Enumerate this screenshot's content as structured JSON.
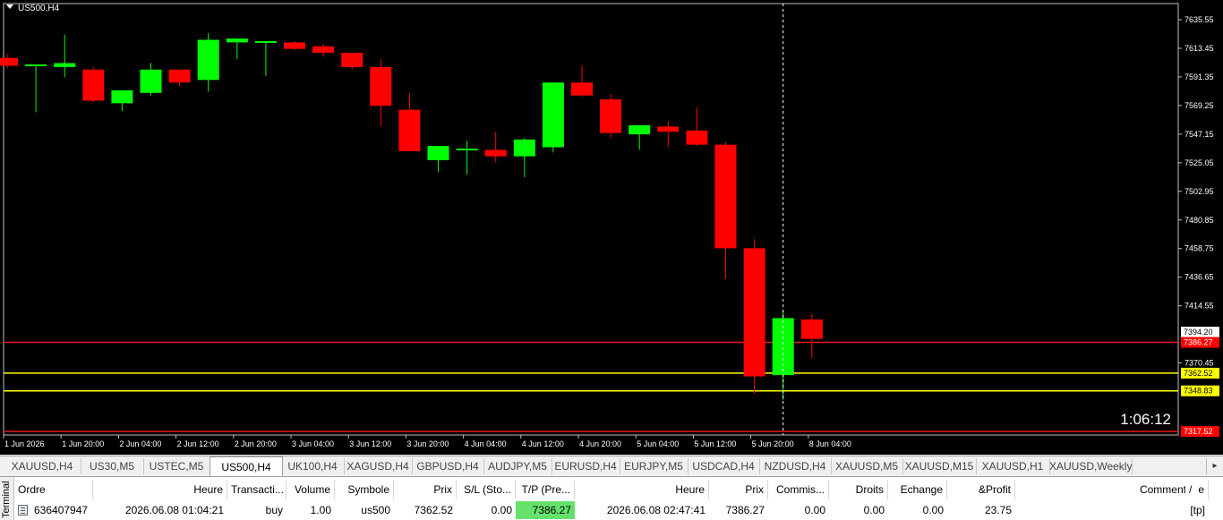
{
  "chart": {
    "symbol": "US500,H4",
    "timer": "1:06:12",
    "colors": {
      "bull": "#00ff00",
      "bear": "#ff0000",
      "wick_bull": "#00ff00",
      "wick_bear": "#ff0000",
      "background": "#000000",
      "axis_text": "#ffffff",
      "level_red": "#e8191b",
      "level_yellow": "#ffff00",
      "crosshair": "#ffffff"
    },
    "price_axis": [
      "7635.55",
      "7613.45",
      "7591.35",
      "7569.25",
      "7547.15",
      "7525.05",
      "7502.95",
      "7480.85",
      "7458.75",
      "7436.65",
      "7414.55",
      "7370.45"
    ],
    "price_tags": [
      {
        "value": 7394.2,
        "label": "7394.20",
        "bg": "#ffffff",
        "fg": "#000000"
      },
      {
        "value": 7386.27,
        "label": "7386.27",
        "bg": "#ff0000",
        "fg": "#ffffff"
      },
      {
        "value": 7362.52,
        "label": "7362.52",
        "bg": "#ffff00",
        "fg": "#000000"
      },
      {
        "value": 7348.83,
        "label": "7348.83",
        "bg": "#ffff00",
        "fg": "#000000"
      },
      {
        "value": 7317.52,
        "label": "7317.52",
        "bg": "#ff0000",
        "fg": "#ffffff"
      }
    ],
    "levels": [
      {
        "value": 7386.27,
        "color": "#e8191b"
      },
      {
        "value": 7362.52,
        "color": "#ffff00"
      },
      {
        "value": 7348.83,
        "color": "#ffff00"
      },
      {
        "value": 7317.52,
        "color": "#e8191b"
      }
    ],
    "time_labels": [
      "1 Jun 2026",
      "1 Jun 20:00",
      "2 Jun 04:00",
      "2 Jun 12:00",
      "2 Jun 20:00",
      "3 Jun 04:00",
      "3 Jun 12:00",
      "3 Jun 20:00",
      "4 Jun 04:00",
      "4 Jun 12:00",
      "4 Jun 20:00",
      "5 Jun 04:00",
      "5 Jun 12:00",
      "5 Jun 20:00",
      "8 Jun 04:00"
    ],
    "candles": [
      {
        "o": 7606,
        "h": 7609,
        "l": 7598,
        "c": 7600
      },
      {
        "o": 7601,
        "h": 7601,
        "l": 7564,
        "c": 7601
      },
      {
        "o": 7599,
        "h": 7624,
        "l": 7591,
        "c": 7602
      },
      {
        "o": 7597,
        "h": 7599,
        "l": 7572,
        "c": 7573
      },
      {
        "o": 7571,
        "h": 7581,
        "l": 7565,
        "c": 7581
      },
      {
        "o": 7579,
        "h": 7602,
        "l": 7577,
        "c": 7597
      },
      {
        "o": 7597,
        "h": 7597,
        "l": 7584,
        "c": 7587
      },
      {
        "o": 7589,
        "h": 7625,
        "l": 7580,
        "c": 7620
      },
      {
        "o": 7618,
        "h": 7621,
        "l": 7605,
        "c": 7621
      },
      {
        "o": 7619,
        "h": 7619,
        "l": 7592,
        "c": 7619
      },
      {
        "o": 7618,
        "h": 7619,
        "l": 7612,
        "c": 7613
      },
      {
        "o": 7615,
        "h": 7617,
        "l": 7607,
        "c": 7610
      },
      {
        "o": 7610,
        "h": 7610,
        "l": 7597,
        "c": 7599
      },
      {
        "o": 7599,
        "h": 7605,
        "l": 7553,
        "c": 7569
      },
      {
        "o": 7566,
        "h": 7579,
        "l": 7541,
        "c": 7534
      },
      {
        "o": 7527,
        "h": 7538,
        "l": 7518,
        "c": 7538
      },
      {
        "o": 7536,
        "h": 7542,
        "l": 7516,
        "c": 7536
      },
      {
        "o": 7535,
        "h": 7549,
        "l": 7525,
        "c": 7530
      },
      {
        "o": 7530,
        "h": 7544,
        "l": 7514,
        "c": 7543
      },
      {
        "o": 7537,
        "h": 7587,
        "l": 7533,
        "c": 7587
      },
      {
        "o": 7587,
        "h": 7600,
        "l": 7576,
        "c": 7577
      },
      {
        "o": 7574,
        "h": 7578,
        "l": 7544,
        "c": 7548
      },
      {
        "o": 7547,
        "h": 7554,
        "l": 7535,
        "c": 7554
      },
      {
        "o": 7553,
        "h": 7557,
        "l": 7537,
        "c": 7549
      },
      {
        "o": 7550,
        "h": 7568,
        "l": 7538,
        "c": 7539
      },
      {
        "o": 7539,
        "h": 7541,
        "l": 7435,
        "c": 7459
      },
      {
        "o": 7459,
        "h": 7466,
        "l": 7347,
        "c": 7360
      },
      {
        "o": 7361,
        "h": 7411,
        "l": 7342,
        "c": 7405
      },
      {
        "o": 7404,
        "h": 7408,
        "l": 7374,
        "c": 7389
      }
    ],
    "ylim": [
      7317.52,
      7635.55
    ],
    "crosshair_candle_index": 27
  },
  "tabs": {
    "active_index": 3,
    "items": [
      "XAUUSD,H4",
      "US30,M5",
      "USTEC,M5",
      "US500,H4",
      "UK100,H4",
      "XAGUSD,H4",
      "GBPUSD,H4",
      "AUDJPY,M5",
      "EURUSD,H4",
      "EURJPY,M5",
      "USDCAD,H4",
      "NZDUSD,H4",
      "XAUUSD,M5",
      "XAUUSD,M15",
      "XAUUSD,H1",
      "XAUUSD,Weekly"
    ]
  },
  "terminal": {
    "side_label": "Terminal",
    "headers": [
      "Ordre",
      "Heure",
      "Transacti...",
      "Volume",
      "Symbole",
      "Prix",
      "S/L (Sto...",
      "T/P (Pre...",
      "Heure",
      "Prix",
      "Commis...",
      "Droits",
      "Echange",
      "&Profit",
      "Commentaire"
    ],
    "row": [
      "636407947",
      "2026.06.08 01:04:21",
      "buy",
      "1.00",
      "us500",
      "7362.52",
      "0.00",
      "7386.27",
      "2026.06.08 02:47:41",
      "7386.27",
      "0.00",
      "0.00",
      "0.00",
      "23.75",
      "[tp]"
    ],
    "sort_indicator": "/"
  }
}
